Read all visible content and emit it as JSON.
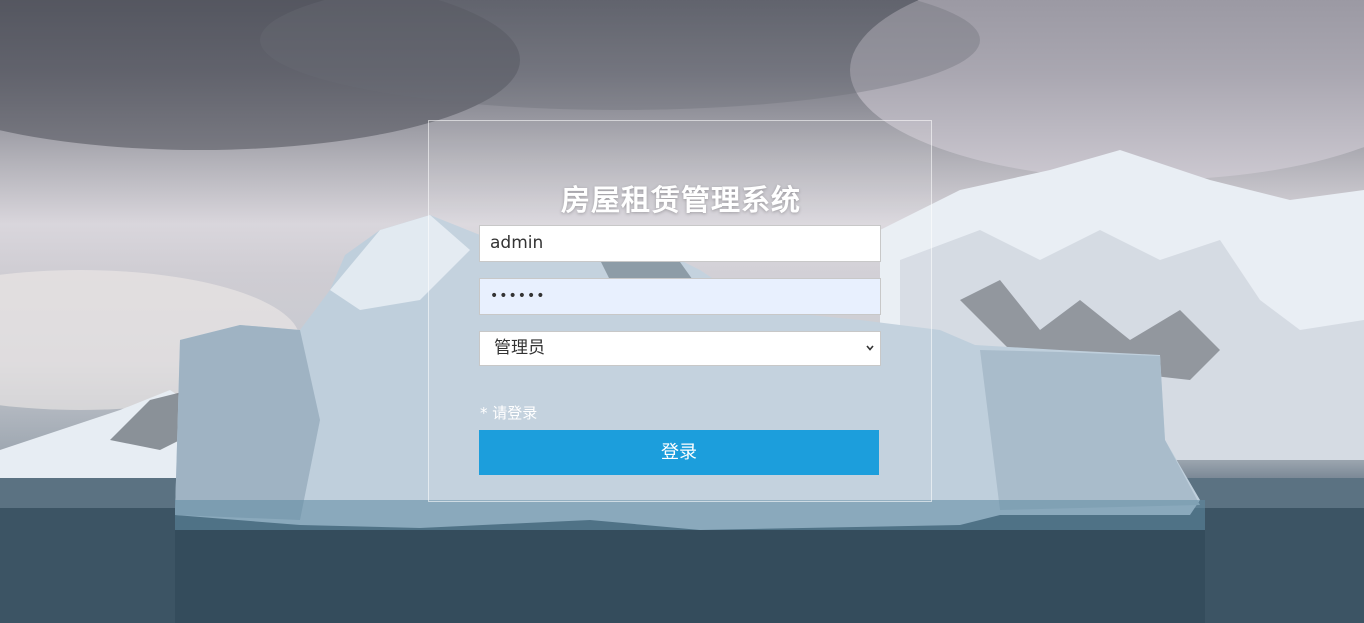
{
  "login": {
    "title": "房屋租赁管理系统",
    "username_value": "admin",
    "password_mask": "••••••",
    "role_selected": "管理员",
    "hint": "* 请登录",
    "submit_label": "登录"
  },
  "colors": {
    "button": "#1c9edc",
    "password_fill": "#e8f0fe"
  }
}
